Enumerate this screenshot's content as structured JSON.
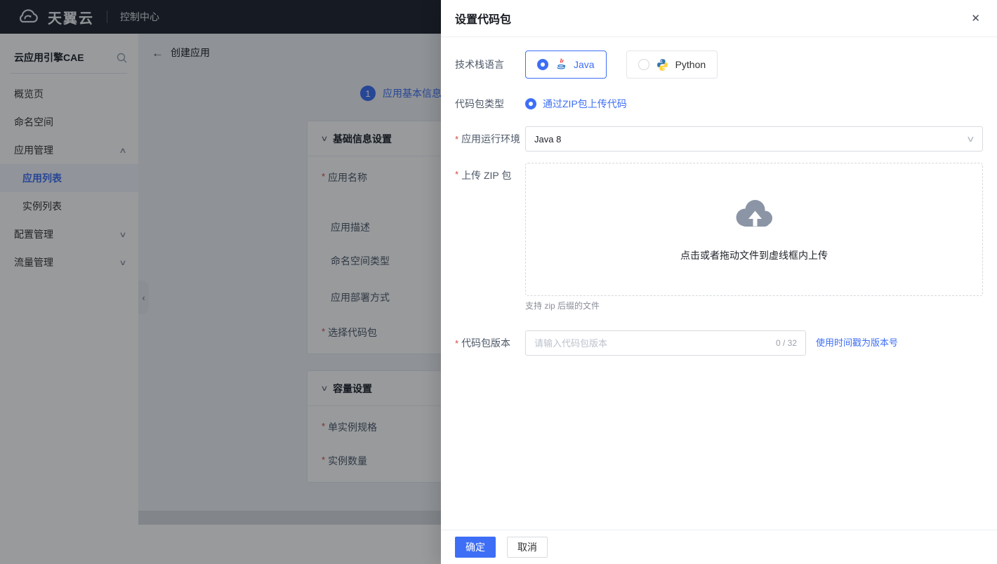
{
  "colors": {
    "accent": "#3d6ef5",
    "danger": "#d54941"
  },
  "marks": {
    "required": "*"
  },
  "icons": {
    "close": "✕",
    "back": "←",
    "chevron_up": "∧",
    "chevron_down": "∨",
    "collapse_left": "‹"
  },
  "topbar": {
    "brand": "天翼云",
    "nav": "控制中心"
  },
  "sidebar": {
    "title": "云应用引擎CAE",
    "items": [
      {
        "label": "概览页"
      },
      {
        "label": "命名空间"
      },
      {
        "label": "应用管理",
        "state": "expanded"
      },
      {
        "label": "应用列表",
        "child": true,
        "selected": true
      },
      {
        "label": "实例列表",
        "child": true
      },
      {
        "label": "配置管理",
        "state": "collapsed"
      },
      {
        "label": "流量管理",
        "state": "collapsed"
      }
    ]
  },
  "page": {
    "back_label": "创建应用",
    "step_number": "1",
    "step_label": "应用基本信息",
    "sections": [
      {
        "title": "基础信息设置",
        "fields": [
          {
            "label": "应用名称",
            "required": true
          },
          {
            "label": "应用描述",
            "required": false
          },
          {
            "label": "命名空间类型",
            "required": false
          },
          {
            "label": "应用部署方式",
            "required": false
          },
          {
            "label": "选择代码包",
            "required": true
          }
        ]
      },
      {
        "title": "容量设置",
        "fields": [
          {
            "label": "单实例规格",
            "required": true
          },
          {
            "label": "实例数量",
            "required": true
          }
        ]
      }
    ]
  },
  "drawer": {
    "title": "设置代码包",
    "tech_stack": {
      "label": "技术栈语言",
      "options": [
        {
          "label": "Java",
          "selected": true
        },
        {
          "label": "Python",
          "selected": false
        }
      ]
    },
    "package_type": {
      "label": "代码包类型",
      "option": "通过ZIP包上传代码",
      "selected": true
    },
    "runtime": {
      "label": "应用运行环境",
      "value": "Java 8"
    },
    "upload": {
      "label": "上传 ZIP 包",
      "drop_text": "点击或者拖动文件到虚线框内上传",
      "hint": "支持 zip 后缀的文件"
    },
    "version": {
      "label": "代码包版本",
      "placeholder": "请输入代码包版本",
      "counter": "0 / 32",
      "link": "使用时间戳为版本号"
    },
    "footer": {
      "confirm": "确定",
      "cancel": "取消"
    }
  }
}
